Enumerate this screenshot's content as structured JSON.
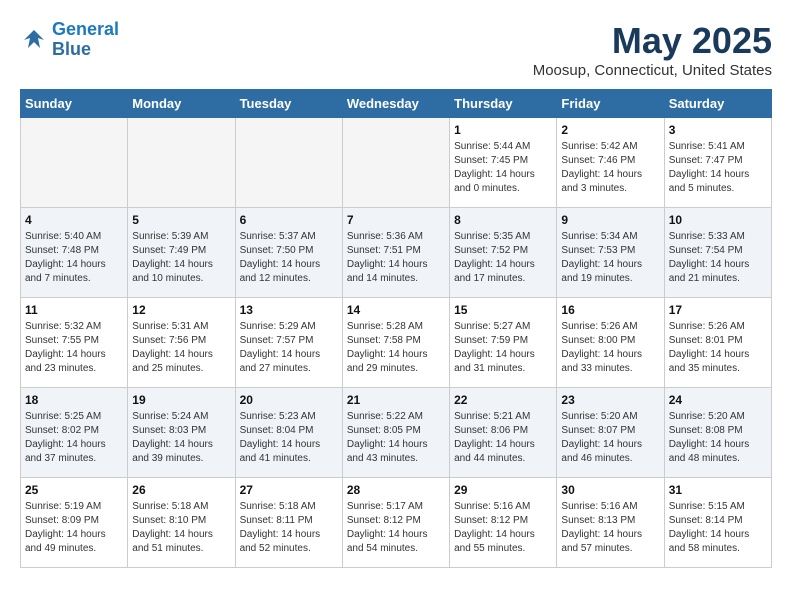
{
  "header": {
    "logo_line1": "General",
    "logo_line2": "Blue",
    "month": "May 2025",
    "location": "Moosup, Connecticut, United States"
  },
  "days_of_week": [
    "Sunday",
    "Monday",
    "Tuesday",
    "Wednesday",
    "Thursday",
    "Friday",
    "Saturday"
  ],
  "weeks": [
    [
      {
        "day": "",
        "empty": true
      },
      {
        "day": "",
        "empty": true
      },
      {
        "day": "",
        "empty": true
      },
      {
        "day": "",
        "empty": true
      },
      {
        "day": "1",
        "sunrise": "Sunrise: 5:44 AM",
        "sunset": "Sunset: 7:45 PM",
        "daylight": "Daylight: 14 hours and 0 minutes."
      },
      {
        "day": "2",
        "sunrise": "Sunrise: 5:42 AM",
        "sunset": "Sunset: 7:46 PM",
        "daylight": "Daylight: 14 hours and 3 minutes."
      },
      {
        "day": "3",
        "sunrise": "Sunrise: 5:41 AM",
        "sunset": "Sunset: 7:47 PM",
        "daylight": "Daylight: 14 hours and 5 minutes."
      }
    ],
    [
      {
        "day": "4",
        "sunrise": "Sunrise: 5:40 AM",
        "sunset": "Sunset: 7:48 PM",
        "daylight": "Daylight: 14 hours and 7 minutes."
      },
      {
        "day": "5",
        "sunrise": "Sunrise: 5:39 AM",
        "sunset": "Sunset: 7:49 PM",
        "daylight": "Daylight: 14 hours and 10 minutes."
      },
      {
        "day": "6",
        "sunrise": "Sunrise: 5:37 AM",
        "sunset": "Sunset: 7:50 PM",
        "daylight": "Daylight: 14 hours and 12 minutes."
      },
      {
        "day": "7",
        "sunrise": "Sunrise: 5:36 AM",
        "sunset": "Sunset: 7:51 PM",
        "daylight": "Daylight: 14 hours and 14 minutes."
      },
      {
        "day": "8",
        "sunrise": "Sunrise: 5:35 AM",
        "sunset": "Sunset: 7:52 PM",
        "daylight": "Daylight: 14 hours and 17 minutes."
      },
      {
        "day": "9",
        "sunrise": "Sunrise: 5:34 AM",
        "sunset": "Sunset: 7:53 PM",
        "daylight": "Daylight: 14 hours and 19 minutes."
      },
      {
        "day": "10",
        "sunrise": "Sunrise: 5:33 AM",
        "sunset": "Sunset: 7:54 PM",
        "daylight": "Daylight: 14 hours and 21 minutes."
      }
    ],
    [
      {
        "day": "11",
        "sunrise": "Sunrise: 5:32 AM",
        "sunset": "Sunset: 7:55 PM",
        "daylight": "Daylight: 14 hours and 23 minutes."
      },
      {
        "day": "12",
        "sunrise": "Sunrise: 5:31 AM",
        "sunset": "Sunset: 7:56 PM",
        "daylight": "Daylight: 14 hours and 25 minutes."
      },
      {
        "day": "13",
        "sunrise": "Sunrise: 5:29 AM",
        "sunset": "Sunset: 7:57 PM",
        "daylight": "Daylight: 14 hours and 27 minutes."
      },
      {
        "day": "14",
        "sunrise": "Sunrise: 5:28 AM",
        "sunset": "Sunset: 7:58 PM",
        "daylight": "Daylight: 14 hours and 29 minutes."
      },
      {
        "day": "15",
        "sunrise": "Sunrise: 5:27 AM",
        "sunset": "Sunset: 7:59 PM",
        "daylight": "Daylight: 14 hours and 31 minutes."
      },
      {
        "day": "16",
        "sunrise": "Sunrise: 5:26 AM",
        "sunset": "Sunset: 8:00 PM",
        "daylight": "Daylight: 14 hours and 33 minutes."
      },
      {
        "day": "17",
        "sunrise": "Sunrise: 5:26 AM",
        "sunset": "Sunset: 8:01 PM",
        "daylight": "Daylight: 14 hours and 35 minutes."
      }
    ],
    [
      {
        "day": "18",
        "sunrise": "Sunrise: 5:25 AM",
        "sunset": "Sunset: 8:02 PM",
        "daylight": "Daylight: 14 hours and 37 minutes."
      },
      {
        "day": "19",
        "sunrise": "Sunrise: 5:24 AM",
        "sunset": "Sunset: 8:03 PM",
        "daylight": "Daylight: 14 hours and 39 minutes."
      },
      {
        "day": "20",
        "sunrise": "Sunrise: 5:23 AM",
        "sunset": "Sunset: 8:04 PM",
        "daylight": "Daylight: 14 hours and 41 minutes."
      },
      {
        "day": "21",
        "sunrise": "Sunrise: 5:22 AM",
        "sunset": "Sunset: 8:05 PM",
        "daylight": "Daylight: 14 hours and 43 minutes."
      },
      {
        "day": "22",
        "sunrise": "Sunrise: 5:21 AM",
        "sunset": "Sunset: 8:06 PM",
        "daylight": "Daylight: 14 hours and 44 minutes."
      },
      {
        "day": "23",
        "sunrise": "Sunrise: 5:20 AM",
        "sunset": "Sunset: 8:07 PM",
        "daylight": "Daylight: 14 hours and 46 minutes."
      },
      {
        "day": "24",
        "sunrise": "Sunrise: 5:20 AM",
        "sunset": "Sunset: 8:08 PM",
        "daylight": "Daylight: 14 hours and 48 minutes."
      }
    ],
    [
      {
        "day": "25",
        "sunrise": "Sunrise: 5:19 AM",
        "sunset": "Sunset: 8:09 PM",
        "daylight": "Daylight: 14 hours and 49 minutes."
      },
      {
        "day": "26",
        "sunrise": "Sunrise: 5:18 AM",
        "sunset": "Sunset: 8:10 PM",
        "daylight": "Daylight: 14 hours and 51 minutes."
      },
      {
        "day": "27",
        "sunrise": "Sunrise: 5:18 AM",
        "sunset": "Sunset: 8:11 PM",
        "daylight": "Daylight: 14 hours and 52 minutes."
      },
      {
        "day": "28",
        "sunrise": "Sunrise: 5:17 AM",
        "sunset": "Sunset: 8:12 PM",
        "daylight": "Daylight: 14 hours and 54 minutes."
      },
      {
        "day": "29",
        "sunrise": "Sunrise: 5:16 AM",
        "sunset": "Sunset: 8:12 PM",
        "daylight": "Daylight: 14 hours and 55 minutes."
      },
      {
        "day": "30",
        "sunrise": "Sunrise: 5:16 AM",
        "sunset": "Sunset: 8:13 PM",
        "daylight": "Daylight: 14 hours and 57 minutes."
      },
      {
        "day": "31",
        "sunrise": "Sunrise: 5:15 AM",
        "sunset": "Sunset: 8:14 PM",
        "daylight": "Daylight: 14 hours and 58 minutes."
      }
    ]
  ]
}
